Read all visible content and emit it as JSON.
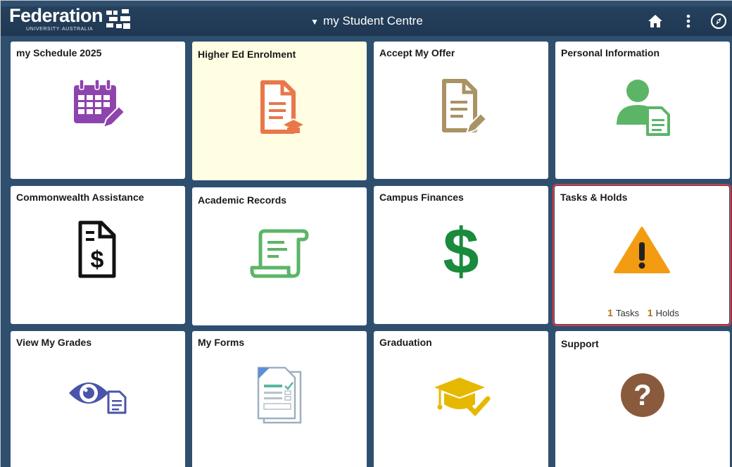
{
  "header": {
    "logo_word": "Federation",
    "logo_sub": "UNIVERSITY·AUSTRALIA",
    "title": "my Student Centre",
    "home_icon": "home-icon",
    "more_icon": "vertical-dots-icon",
    "nav_icon": "compass-icon"
  },
  "tiles": [
    {
      "title": "my Schedule 2025",
      "icon": "calendar-edit-icon",
      "color": "#8e44ad"
    },
    {
      "title": "Higher Ed Enrolment",
      "icon": "document-graduation-icon",
      "color": "#e8774a"
    },
    {
      "title": "Accept My Offer",
      "icon": "document-edit-icon",
      "color": "#a99364"
    },
    {
      "title": "Personal Information",
      "icon": "person-document-icon",
      "color": "#5cb567"
    },
    {
      "title": "Commonwealth Assistance",
      "icon": "document-dollar-icon",
      "color": "#111111"
    },
    {
      "title": "Academic Records",
      "icon": "scroll-icon",
      "color": "#5cb567"
    },
    {
      "title": "Campus Finances",
      "icon": "dollar-icon",
      "color": "#1a8a3c"
    },
    {
      "title": "Tasks & Holds",
      "icon": "warning-icon",
      "color": "#f39c12"
    },
    {
      "title": "View My Grades",
      "icon": "eye-document-icon",
      "color": "#4a54a8"
    },
    {
      "title": "My Forms",
      "icon": "forms-icon",
      "color": "#8aa2b8"
    },
    {
      "title": "Graduation",
      "icon": "graduation-cap-check-icon",
      "color": "#e6b800"
    },
    {
      "title": "Support",
      "icon": "question-icon",
      "color": "#8a5a3c"
    }
  ],
  "tasks_holds": {
    "tasks_count": "1",
    "tasks_label": "Tasks",
    "holds_count": "1",
    "holds_label": "Holds"
  }
}
